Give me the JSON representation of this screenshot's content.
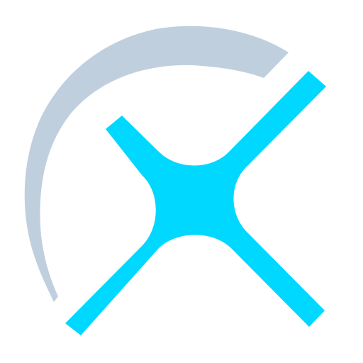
{
  "logo": {
    "icon": "x-cross-with-arc-icon",
    "colors": {
      "arc": "#c0cfdd",
      "cross": "#00d8ff",
      "background": "#ffffff"
    }
  }
}
